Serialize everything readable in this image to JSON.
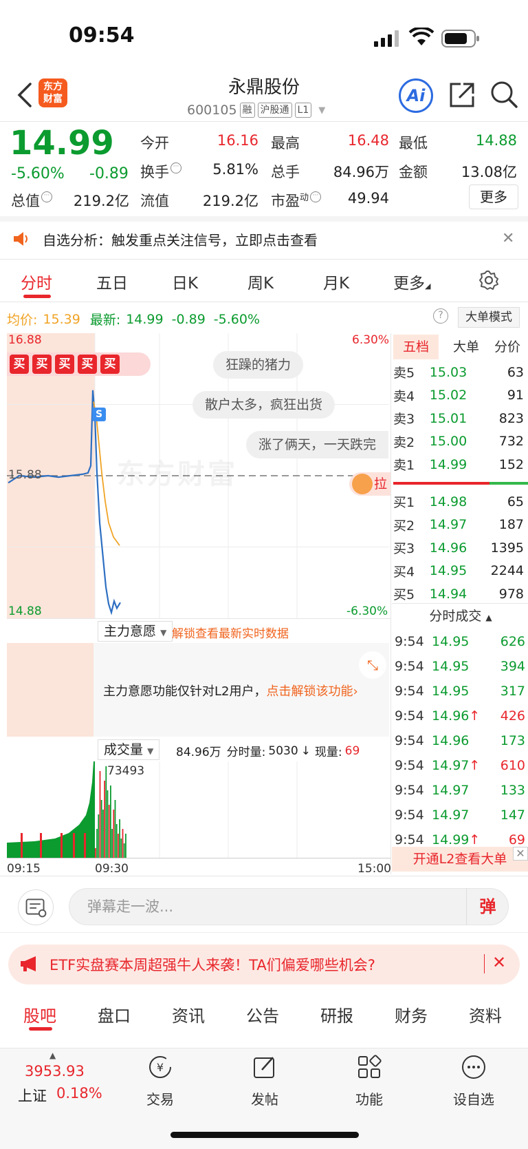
{
  "status_bar": {
    "time": "09:54"
  },
  "header": {
    "logo_line1": "东方",
    "logo_line2": "财富",
    "stock_name": "永鼎股份",
    "stock_code": "600105",
    "tags": [
      "融",
      "沪股通",
      "L1"
    ],
    "ai_label": "Ai"
  },
  "quote": {
    "price": "14.99",
    "change_pct": "-5.60%",
    "change_abs": "-0.89",
    "open_label": "今开",
    "open": "16.16",
    "high_label": "最高",
    "high": "16.48",
    "low_label": "最低",
    "low": "14.88",
    "turnover_label": "换手",
    "turnover": "5.81%",
    "volume_label": "总手",
    "volume": "84.96万",
    "amount_label": "金额",
    "amount": "13.08亿",
    "mktcap_label": "总值",
    "mktcap": "219.2亿",
    "float_label": "流值",
    "float": "219.2亿",
    "pe_label": "市盈",
    "pe_sup": "动",
    "pe": "49.94",
    "more_label": "更多"
  },
  "notice": {
    "text": "自选分析：触发重点关注信号，立即点击查看"
  },
  "tabs": [
    "分时",
    "五日",
    "日K",
    "周K",
    "月K",
    "更多"
  ],
  "avg_row": {
    "avg_label": "均价:",
    "avg": "15.39",
    "latest_label": "最新:",
    "latest": "14.99",
    "latest_chg": "-0.89",
    "latest_pct": "-5.60%",
    "help": "?",
    "big_order_mode": "大单模式"
  },
  "chart_data": {
    "type": "line",
    "title": "",
    "y_max_label": "16.88",
    "y_mid_label": "15.88",
    "y_min_label": "14.88",
    "pct_max_label": "6.30%",
    "pct_min_label": "-6.30%",
    "ylim": [
      14.88,
      16.88
    ],
    "prev_close": 15.88,
    "series": [
      {
        "values": [
          15.83,
          15.88,
          15.87,
          15.88,
          15.87,
          15.88,
          15.89,
          15.9,
          15.95,
          16.48,
          16.3,
          15.9,
          15.55,
          15.3,
          15.1,
          14.98,
          14.92,
          15.0,
          14.95,
          14.99
        ]
      },
      {
        "values": [
          16.4,
          16.3,
          16.1,
          15.9,
          15.7,
          15.55,
          15.45,
          15.39
        ]
      }
    ],
    "time_labels": [
      "09:15",
      "09:30",
      "15:00"
    ],
    "marker": "S"
  },
  "danmu": [
    "狂躁的猪力",
    "散户太多，疯狂出货",
    "涨了俩天，一天跌完"
  ],
  "buy_badges": [
    "买",
    "买",
    "买",
    "买",
    "买"
  ],
  "la_label": "拉",
  "watermark": "东方财富",
  "order_book": {
    "tabs": [
      "五档",
      "大单",
      "分价"
    ],
    "sells": [
      {
        "label": "卖5",
        "price": "15.03",
        "vol": "63"
      },
      {
        "label": "卖4",
        "price": "15.02",
        "vol": "91"
      },
      {
        "label": "卖3",
        "price": "15.01",
        "vol": "823"
      },
      {
        "label": "卖2",
        "price": "15.00",
        "vol": "732"
      },
      {
        "label": "卖1",
        "price": "14.99",
        "vol": "152"
      }
    ],
    "buys": [
      {
        "label": "买1",
        "price": "14.98",
        "vol": "65"
      },
      {
        "label": "买2",
        "price": "14.97",
        "vol": "187"
      },
      {
        "label": "买3",
        "price": "14.96",
        "vol": "1395"
      },
      {
        "label": "买4",
        "price": "14.95",
        "vol": "2244"
      },
      {
        "label": "买5",
        "price": "14.94",
        "vol": "978"
      }
    ],
    "trades_title": "分时成交",
    "trades": [
      {
        "t": "9:54",
        "p": "14.95",
        "v": "626",
        "up": false,
        "vred": false
      },
      {
        "t": "9:54",
        "p": "14.95",
        "v": "394",
        "up": false,
        "vred": false
      },
      {
        "t": "9:54",
        "p": "14.95",
        "v": "317",
        "up": false,
        "vred": false
      },
      {
        "t": "9:54",
        "p": "14.96",
        "v": "426",
        "up": true,
        "vred": true
      },
      {
        "t": "9:54",
        "p": "14.96",
        "v": "173",
        "up": false,
        "vred": false
      },
      {
        "t": "9:54",
        "p": "14.97",
        "v": "610",
        "up": true,
        "vred": true
      },
      {
        "t": "9:54",
        "p": "14.97",
        "v": "133",
        "up": false,
        "vred": false
      },
      {
        "t": "9:54",
        "p": "14.97",
        "v": "147",
        "up": false,
        "vred": false
      },
      {
        "t": "9:54",
        "p": "14.99",
        "v": "69",
        "up": true,
        "vred": true
      }
    ],
    "l2_label": "开通L2查看大单"
  },
  "main_force": {
    "label": "主力意愿",
    "unlock": "解锁查看最新实时数据",
    "text": "主力意愿功能仅针对L2用户，",
    "text_link": "点击解锁该功能"
  },
  "volume": {
    "label": "成交量",
    "total": "84.96万",
    "min_label": "分时量:",
    "min_val": "5030",
    "now_label": "现量:",
    "now_val": "69",
    "peak": "73493"
  },
  "comment": {
    "placeholder": "弹幕走一波...",
    "danmu_btn": "弹"
  },
  "ad": {
    "text": "ETF实盘赛本周超强牛人来袭！TA们偏爱哪些机会?"
  },
  "bottom_tabs": [
    "股吧",
    "盘口",
    "资讯",
    "公告",
    "研报",
    "财务",
    "资料"
  ],
  "dock": {
    "index_value": "3953.93",
    "index_name": "上证",
    "index_pct": "0.18%",
    "items": [
      "交易",
      "发帖",
      "功能",
      "设自选"
    ]
  },
  "colors": {
    "up": "#e8262c",
    "down": "#0b9b2f",
    "price_line": "#2d6fc2",
    "avg_line": "#f0a325",
    "accent": "#f0641e"
  }
}
